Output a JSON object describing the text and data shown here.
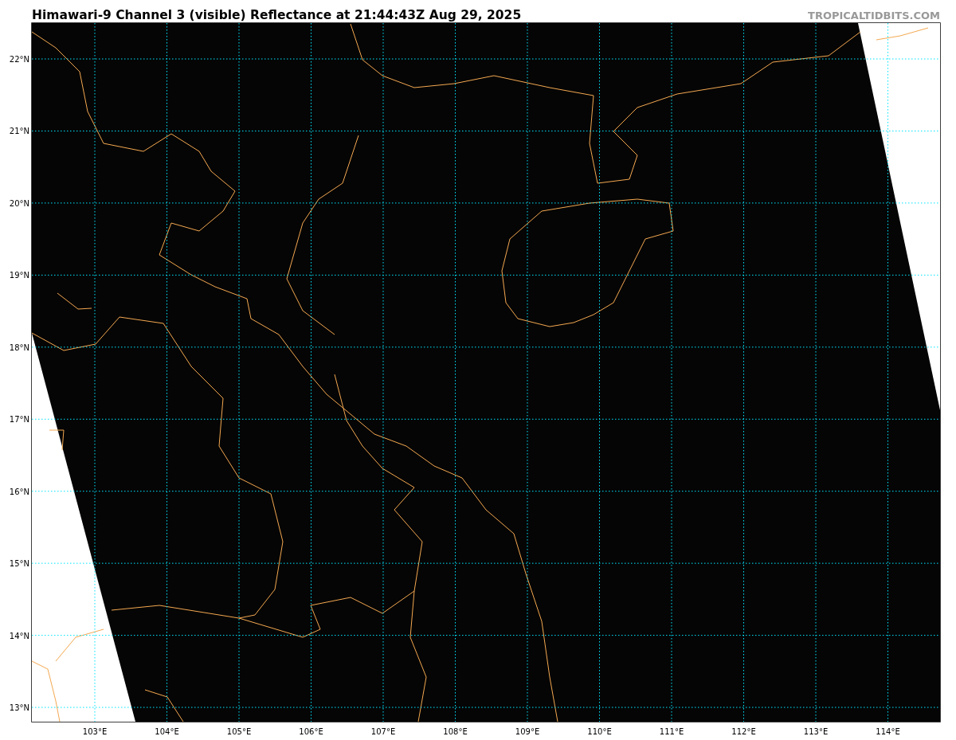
{
  "title": "Himawari-9 Channel 3 (visible) Reflectance at 21:44:43Z Aug 29, 2025",
  "credit": "TROPICALTIDBITS.COM",
  "map": {
    "x_ticks": [
      "103°E",
      "104°E",
      "105°E",
      "106°E",
      "107°E",
      "108°E",
      "109°E",
      "110°E",
      "111°E",
      "112°E",
      "113°E",
      "114°E"
    ],
    "y_ticks": [
      "22°N",
      "21°N",
      "20°N",
      "19°N",
      "18°N",
      "17°N",
      "16°N",
      "15°N",
      "14°N",
      "13°N"
    ]
  }
}
